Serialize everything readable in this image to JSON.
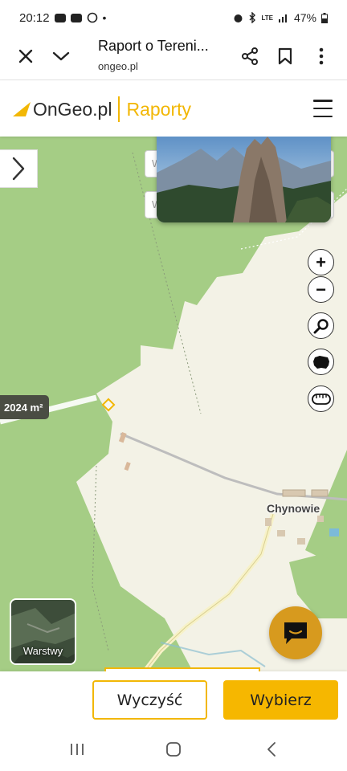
{
  "status_bar": {
    "time": "20:12",
    "dot": "•",
    "network": "LTE",
    "battery": "47%",
    "icons": [
      "youtube-icon",
      "youtube-icon",
      "whatsapp-icon",
      "alarm-icon",
      "bluetooth-icon",
      "lte-icon",
      "signal-icon",
      "battery-icon"
    ]
  },
  "browser": {
    "page_title": "Raport o Tereni...",
    "url": "ongeo.pl",
    "icons": [
      "close-icon",
      "chevron-down-icon",
      "share-icon",
      "bookmark-icon",
      "more-vertical-icon"
    ]
  },
  "site": {
    "logo_name": "OnGeo.pl",
    "logo_sub": "Raporty",
    "accent": "#f2b705",
    "menu_icon": "hamburger-icon"
  },
  "map": {
    "search_placeholder_1": "W",
    "search_placeholder_2": "W",
    "area_label": "2024 m²",
    "place_label": "Chynowie",
    "zoom_in": "+",
    "zoom_out": "−",
    "tools": [
      "zoom-in-icon",
      "zoom-out-icon",
      "search-icon",
      "poland-map-icon",
      "measure-tape-icon"
    ],
    "layers_label": "Warstwy",
    "colors": {
      "forest": "#a5cd85",
      "open": "#f3f2e6",
      "road": "#f7f2c8"
    }
  },
  "actions": {
    "clear_label": "Wyczyść",
    "select_label": "Wybierz"
  },
  "nav": {
    "icons": [
      "recent-apps-icon",
      "home-icon",
      "back-icon"
    ]
  }
}
